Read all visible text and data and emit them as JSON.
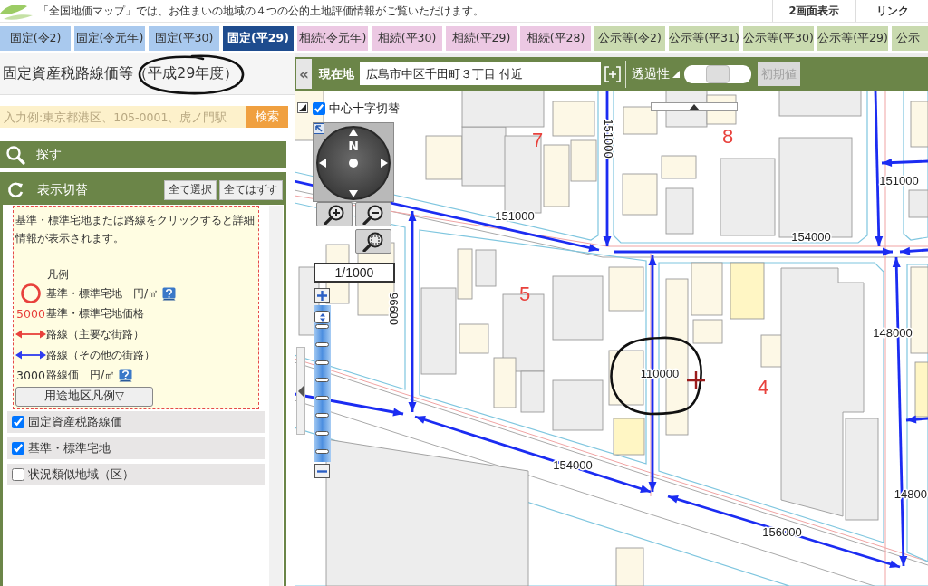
{
  "header": {
    "notice": "「全国地価マップ」では、お住まいの地域の４つの公的土地評価情報がご覧いただけます。",
    "buttons": [
      "2画面表示",
      "リンク"
    ]
  },
  "tabs": [
    {
      "label": "固定(令2)",
      "kind": "fixed",
      "selected": false
    },
    {
      "label": "固定(令元年)",
      "kind": "fixed",
      "selected": false
    },
    {
      "label": "固定(平30)",
      "kind": "fixed",
      "selected": false
    },
    {
      "label": "固定(平29)",
      "kind": "fixed",
      "selected": true
    },
    {
      "label": "相続(令元年)",
      "kind": "inheritance",
      "selected": false
    },
    {
      "label": "相続(平30)",
      "kind": "inheritance",
      "selected": false
    },
    {
      "label": "相続(平29)",
      "kind": "inheritance",
      "selected": false
    },
    {
      "label": "相続(平28)",
      "kind": "inheritance",
      "selected": false
    },
    {
      "label": "公示等(令2)",
      "kind": "public",
      "selected": false
    },
    {
      "label": "公示等(平31)",
      "kind": "public",
      "selected": false
    },
    {
      "label": "公示等(平30)",
      "kind": "public",
      "selected": false
    },
    {
      "label": "公示等(平29)",
      "kind": "public",
      "selected": false
    },
    {
      "label": "公示",
      "kind": "public",
      "selected": false
    }
  ],
  "sidebar": {
    "title": {
      "text": "固定資産税路線価等（平成29年度）",
      "circled": true
    },
    "search": {
      "placeholder": "入力例:東京都港区、105-0001、虎ノ門駅",
      "button": "検索"
    },
    "find_section": {
      "label": "探す"
    },
    "display_section": {
      "label": "表示切替",
      "buttons": [
        "全て選択",
        "全てはずす"
      ],
      "info": "基準・標準宅地または路線をクリックすると詳細情報が表示されます。",
      "legend_title": "凡例",
      "legend": [
        {
          "kind": "ring",
          "color": "#e8413c",
          "label": "基準・標準宅地　円/㎡",
          "help": true
        },
        {
          "kind": "number",
          "sample": "5000",
          "color": "#e8413c",
          "label": "基準・標準宅地価格",
          "help": false
        },
        {
          "kind": "arrow",
          "color": "#e8413c",
          "label": "路線（主要な街路）",
          "help": false
        },
        {
          "kind": "arrow",
          "color": "#2f3cf0",
          "label": "路線（その他の街路）",
          "help": false
        },
        {
          "kind": "number",
          "sample": "3000",
          "color": "#333333",
          "label": "路線価　円/㎡",
          "help": true
        }
      ],
      "zoning_button": "用途地区凡例▽",
      "layers": [
        {
          "label": "固定資産税路線価",
          "checked": true
        },
        {
          "label": "基準・標準宅地",
          "checked": true
        },
        {
          "label": "状況類似地域（区）",
          "checked": false
        }
      ]
    }
  },
  "map_toolbar": {
    "collapse_button": "«",
    "location_label": "現在地",
    "location": "広島市中区千田町３丁目 付近",
    "transparency_label": "透過性",
    "transparency": {
      "level": 0.5
    },
    "reset_button": {
      "label": "初期値",
      "disabled": true
    }
  },
  "map": {
    "crosshair_toggle": {
      "label": "中心十字切替",
      "checked": true
    },
    "compass_north": "N",
    "scale": "1/1000",
    "zoom": {
      "level": 0.96
    },
    "block_numbers": [
      "7",
      "8",
      "5",
      "4"
    ],
    "route_prices": [
      {
        "text": "151000",
        "circled": false
      },
      {
        "text": "151000",
        "circled": false
      },
      {
        "text": "151000",
        "circled": false
      },
      {
        "text": "154000",
        "circled": false
      },
      {
        "text": "96600",
        "circled": false
      },
      {
        "text": "148000",
        "circled": false
      },
      {
        "text": "110000",
        "circled": true
      },
      {
        "text": "154000",
        "circled": false
      },
      {
        "text": "14800",
        "circled": false
      },
      {
        "text": "156000",
        "circled": false
      }
    ]
  }
}
